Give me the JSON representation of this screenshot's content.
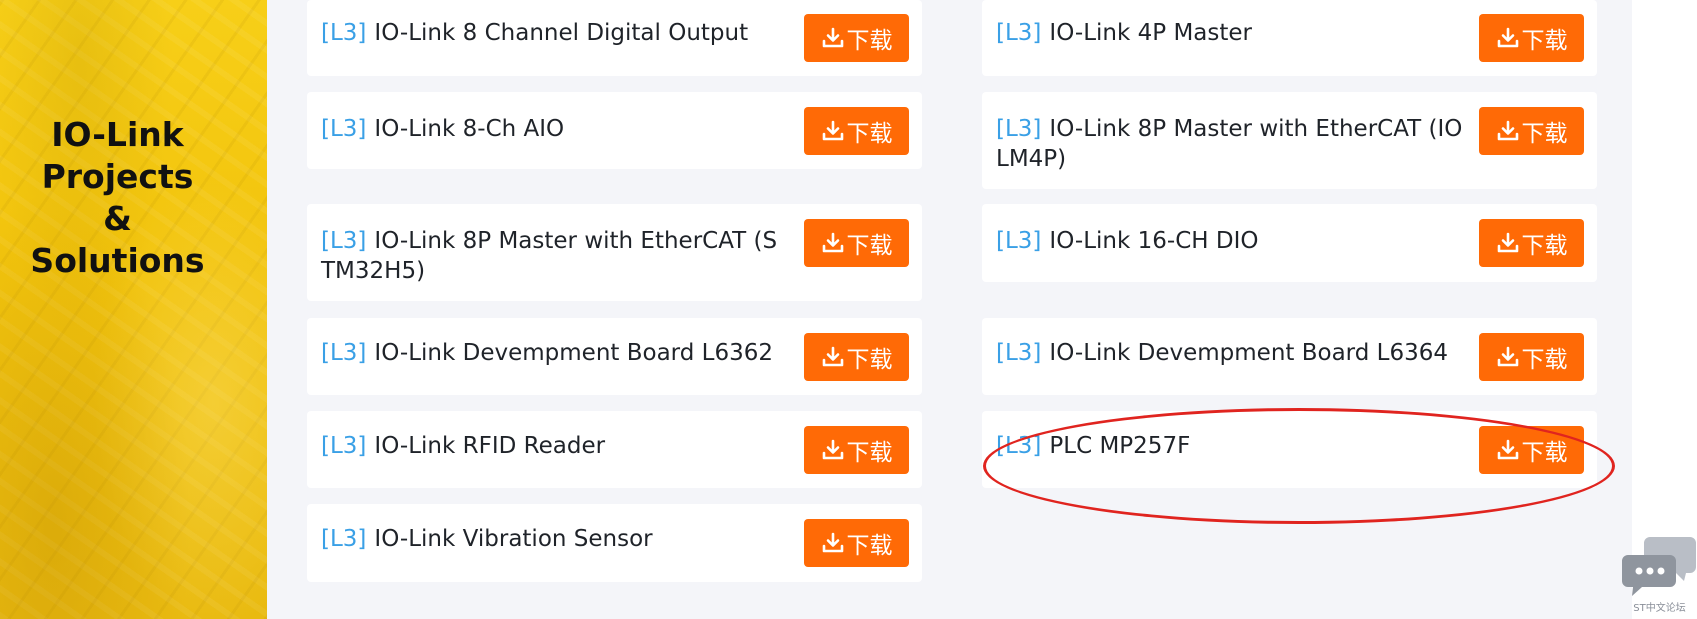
{
  "banner": {
    "title_lines": [
      "IO-Link",
      "Projects",
      "&",
      "Solutions"
    ]
  },
  "download_label": "下载",
  "download_icon": "download-icon",
  "accent_color": "#ff6a06",
  "tag_color": "#3aa0e6",
  "left_column": [
    {
      "tag": "[L3]",
      "title": "IO-Link 8 Channel Digital Output"
    },
    {
      "tag": "[L3]",
      "title": "IO-Link 8-Ch AIO"
    },
    {
      "tag": "[L3]",
      "title": "IO-Link 8P Master with EtherCAT (STM32H5)"
    },
    {
      "tag": "[L3]",
      "title": "IO-Link Devempment Board L6362"
    },
    {
      "tag": "[L3]",
      "title": "IO-Link RFID Reader"
    },
    {
      "tag": "[L3]",
      "title": "IO-Link Vibration Sensor"
    }
  ],
  "right_column": [
    {
      "tag": "[L3]",
      "title": "IO-Link 4P Master"
    },
    {
      "tag": "[L3]",
      "title": "IO-Link 8P Master with EtherCAT (IOLM4P)"
    },
    {
      "tag": "[L3]",
      "title": "IO-Link 16-CH DIO"
    },
    {
      "tag": "[L3]",
      "title": "IO-Link Devempment Board L6364"
    },
    {
      "tag": "[L3]",
      "title": "PLC MP257F"
    }
  ],
  "annotation": {
    "highlighted_item": "PLC MP257F",
    "color": "#e0241f"
  },
  "chat_widget": {
    "caption": "ST中文论坛",
    "icon": "chat-bubbles-icon"
  }
}
